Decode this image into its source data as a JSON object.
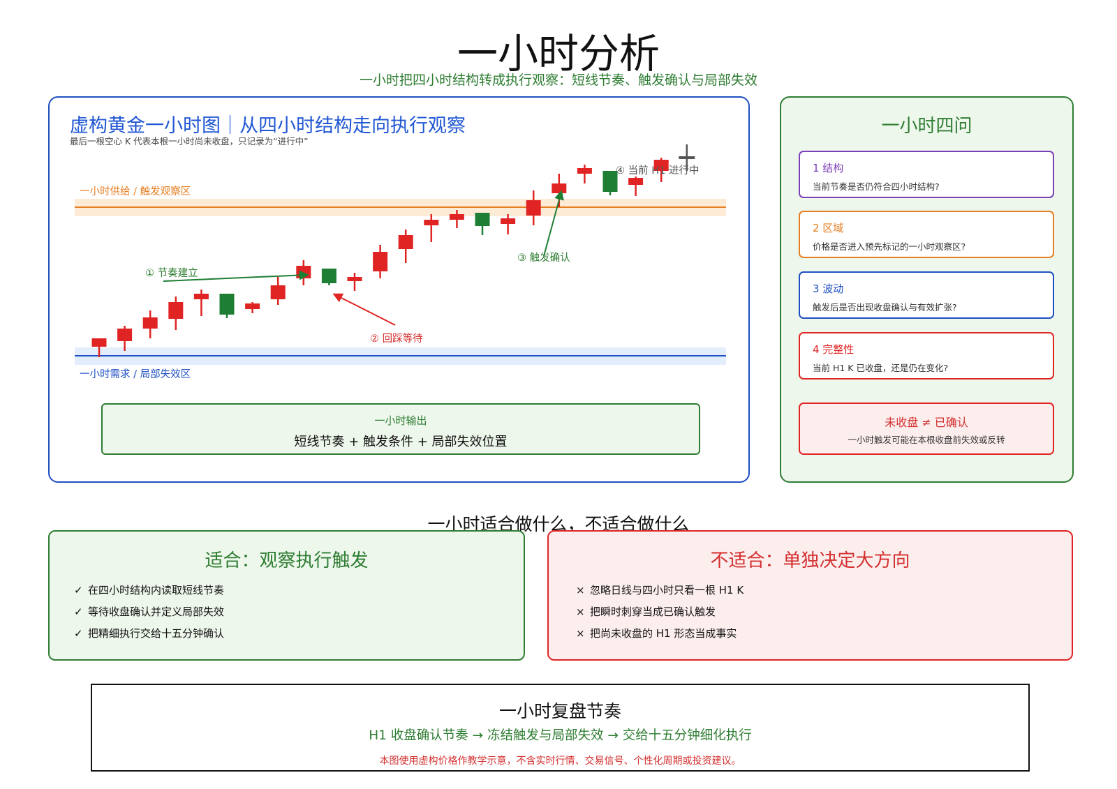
{
  "title": "一小时分析",
  "subtitle": "一小时把四小时结构转成执行观察：短线节奏、触发确认与局部失效",
  "chart_panel": {
    "heading": "虚构黄金一小时图｜从四小时结构走向执行观察",
    "note": "最后一根空心 K 代表本根一小时尚未收盘，只记录为“进行中”",
    "supply_label": "一小时供给 / 触发观察区",
    "demand_label": "一小时需求 / 局部失效区",
    "annotations": [
      "① 节奏建立",
      "② 回踩等待",
      "③ 触发确认",
      "④ 当前 H1 进行中"
    ],
    "output_title": "一小时输出",
    "output_body": "短线节奏 + 触发条件 + 局部失效位置"
  },
  "colors": {
    "up": "#e02424",
    "down": "#1e7e34",
    "supply": "#e67e22",
    "demand": "#1e4fc2",
    "green": "#2e7d32",
    "red": "#d32f2f",
    "purple": "#7b3fb8",
    "orange": "#e67e22",
    "blue": "#1e4fc2"
  },
  "questions_panel": {
    "heading": "一小时四问",
    "cards": [
      {
        "title": "1 结构",
        "text": "当前节奏是否仍符合四小时结构?",
        "color": "#7b3fb8"
      },
      {
        "title": "2 区域",
        "text": "价格是否进入预先标记的一小时观察区?",
        "color": "#e67e22"
      },
      {
        "title": "3 波动",
        "text": "触发后是否出现收盘确认与有效扩张?",
        "color": "#1e4fc2"
      },
      {
        "title": "4 完整性",
        "text": "当前 H1 K 已收盘，还是仍在变化?",
        "color": "#e02424"
      }
    ],
    "warning_title": "未收盘 ≠ 已确认",
    "warning_text": "一小时触发可能在本根收盘前失效或反转"
  },
  "section_title": "一小时适合做什么，不适合做什么",
  "fit": {
    "title": "适合：观察执行触发",
    "mark": "✓",
    "items": [
      "在四小时结构内读取短线节奏",
      "等待收盘确认并定义局部失效",
      "把精细执行交给十五分钟确认"
    ]
  },
  "not_fit": {
    "title": "不适合：单独决定大方向",
    "mark": "×",
    "items": [
      "忽略日线与四小时只看一根 H1 K",
      "把瞬时刺穿当成已确认触发",
      "把尚未收盘的 H1 形态当成事实"
    ]
  },
  "review": {
    "title": "一小时复盘节奏",
    "flow": "H1 收盘确认节奏 → 冻结触发与局部失效 → 交给十五分钟细化执行",
    "disclaimer": "本图使用虚构价格作教学示意，不含实时行情、交易信号、个性化周期或投资建议。"
  },
  "candles": [
    {
      "o": 4,
      "h": 14,
      "l": -11,
      "c": 16
    },
    {
      "o": 12,
      "h": 34,
      "l": -2,
      "c": 30
    },
    {
      "o": 30,
      "h": 56,
      "l": 16,
      "c": 46
    },
    {
      "o": 44,
      "h": 76,
      "l": 28,
      "c": 68
    },
    {
      "o": 72,
      "h": 86,
      "l": 48,
      "c": 80
    },
    {
      "o": 80,
      "h": 80,
      "l": 45,
      "c": 50
    },
    {
      "o": 58,
      "h": 68,
      "l": 52,
      "c": 66
    },
    {
      "o": 72,
      "h": 104,
      "l": 64,
      "c": 92
    },
    {
      "o": 102,
      "h": 128,
      "l": 92,
      "c": 120
    },
    {
      "o": 116,
      "h": 116,
      "l": 92,
      "c": 95
    },
    {
      "o": 98,
      "h": 110,
      "l": 84,
      "c": 104
    },
    {
      "o": 112,
      "h": 150,
      "l": 102,
      "c": 140
    },
    {
      "o": 144,
      "h": 172,
      "l": 124,
      "c": 164
    },
    {
      "o": 178,
      "h": 194,
      "l": 154,
      "c": 186
    },
    {
      "o": 186,
      "h": 200,
      "l": 174,
      "c": 194
    },
    {
      "o": 196,
      "h": 196,
      "l": 164,
      "c": 177
    },
    {
      "o": 180,
      "h": 194,
      "l": 165,
      "c": 188
    },
    {
      "o": 192,
      "h": 228,
      "l": 178,
      "c": 214
    },
    {
      "o": 224,
      "h": 252,
      "l": 204,
      "c": 238
    },
    {
      "o": 252,
      "h": 265,
      "l": 238,
      "c": 260
    },
    {
      "o": 256,
      "h": 256,
      "l": 221,
      "c": 226
    },
    {
      "o": 236,
      "h": 248,
      "l": 220,
      "c": 246
    },
    {
      "o": 256,
      "h": 275,
      "l": 240,
      "c": 272
    },
    {
      "o": 276,
      "h": 294,
      "l": 256,
      "c": 276
    }
  ]
}
